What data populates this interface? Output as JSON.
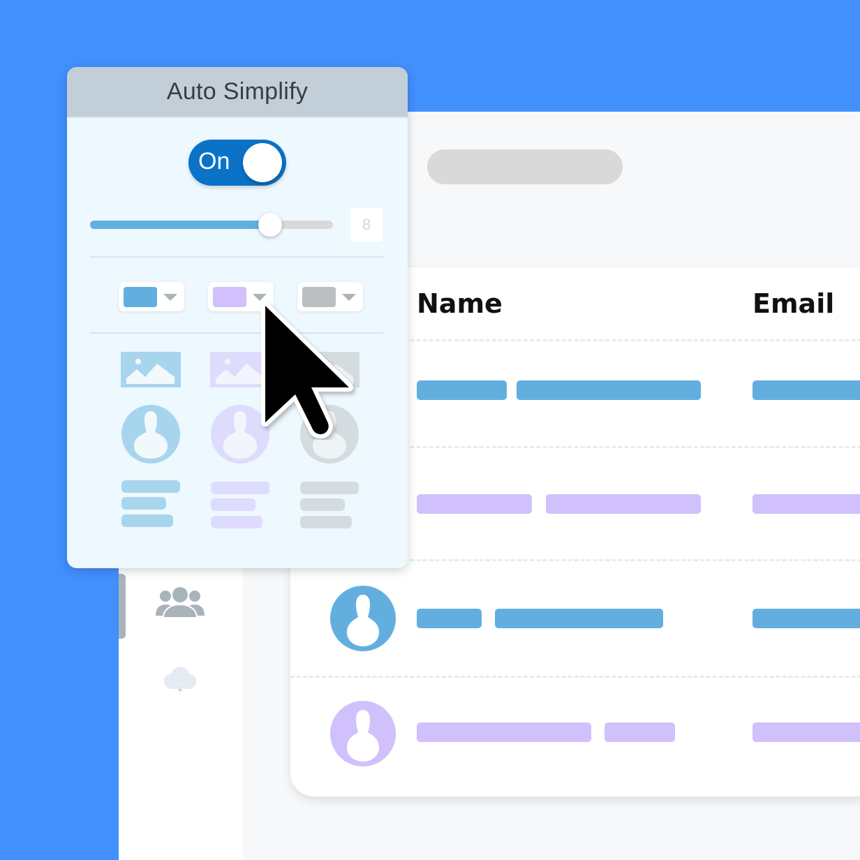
{
  "colors": {
    "background": "#428ffe",
    "blue": "#62afdf",
    "purple": "#d0c0fb",
    "gray": "#bcbec0",
    "blue_light": "#a8d5ee",
    "purple_light": "#dedcfd",
    "gray_light": "#d4dce0",
    "toggle_on": "#0a73c8"
  },
  "panel": {
    "title": "Auto Simplify",
    "toggle": {
      "label": "On",
      "state": "on"
    },
    "slider": {
      "value": 8,
      "fill_fraction": 0.74,
      "value_label": "8"
    },
    "color_selects": [
      {
        "name": "blue",
        "color": "#62afdf"
      },
      {
        "name": "purple",
        "color": "#d0c0fb"
      },
      {
        "name": "gray",
        "color": "#bcbec0"
      }
    ],
    "previews": [
      {
        "name": "blue",
        "color": "#a8d5ee"
      },
      {
        "name": "purple",
        "color": "#dedcfd"
      },
      {
        "name": "gray",
        "color": "#d4dce0"
      }
    ]
  },
  "sidebar": {
    "items": [
      {
        "icon": "users-icon",
        "active": true
      },
      {
        "icon": "cloud-lightning-icon",
        "active": false
      }
    ]
  },
  "table": {
    "columns": [
      "Name",
      "Email"
    ],
    "rows": [
      {
        "avatar": false,
        "color": "blue"
      },
      {
        "avatar": false,
        "color": "purple"
      },
      {
        "avatar": true,
        "color": "blue"
      },
      {
        "avatar": true,
        "color": "purple"
      }
    ]
  }
}
